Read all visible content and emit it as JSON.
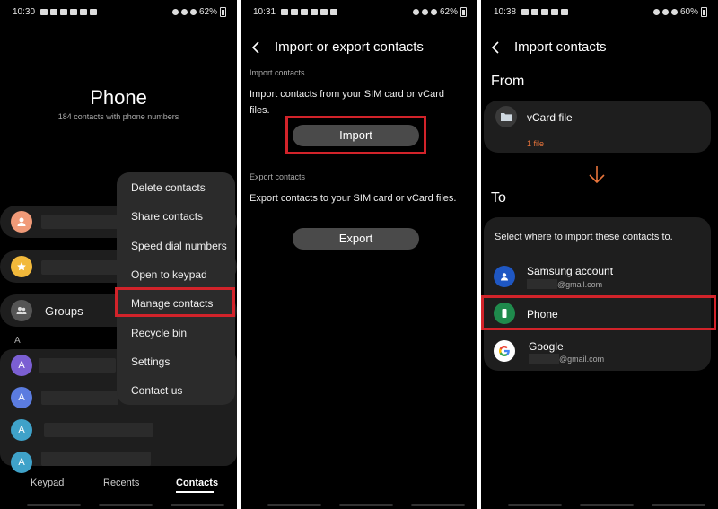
{
  "screen1": {
    "status": {
      "time": "10:30",
      "battery": "62%"
    },
    "title": "Phone",
    "subtitle": "184 contacts with phone numbers",
    "groups_label": "Groups",
    "section_letter": "A",
    "avatar_letter": "A",
    "menu": [
      "Delete contacts",
      "Share contacts",
      "Speed dial numbers",
      "Open to keypad",
      "Manage contacts",
      "Recycle bin",
      "Settings",
      "Contact us"
    ],
    "tabs": [
      "Keypad",
      "Recents",
      "Contacts"
    ]
  },
  "screen2": {
    "status": {
      "time": "10:31",
      "battery": "62%"
    },
    "header": "Import or export contacts",
    "import_section": "Import contacts",
    "import_desc": "Import contacts from your SIM card or vCard files.",
    "import_button": "Import",
    "export_section": "Export contacts",
    "export_desc": "Export contacts to your SIM card or vCard files.",
    "export_button": "Export"
  },
  "screen3": {
    "status": {
      "time": "10:38",
      "battery": "60%"
    },
    "header": "Import contacts",
    "from_label": "From",
    "vcard_title": "vCard file",
    "vcard_count": "1 file",
    "to_label": "To",
    "to_prompt": "Select where to import these contacts to.",
    "samsung_title": "Samsung account",
    "samsung_email": "@gmail.com",
    "phone_title": "Phone",
    "google_title": "Google",
    "google_email": "@gmail.com"
  },
  "colors": {
    "highlight": "#d2232a",
    "accent_orange": "#e8743b",
    "samsung_blue": "#1f57c3",
    "phone_green": "#1f8a4c"
  }
}
